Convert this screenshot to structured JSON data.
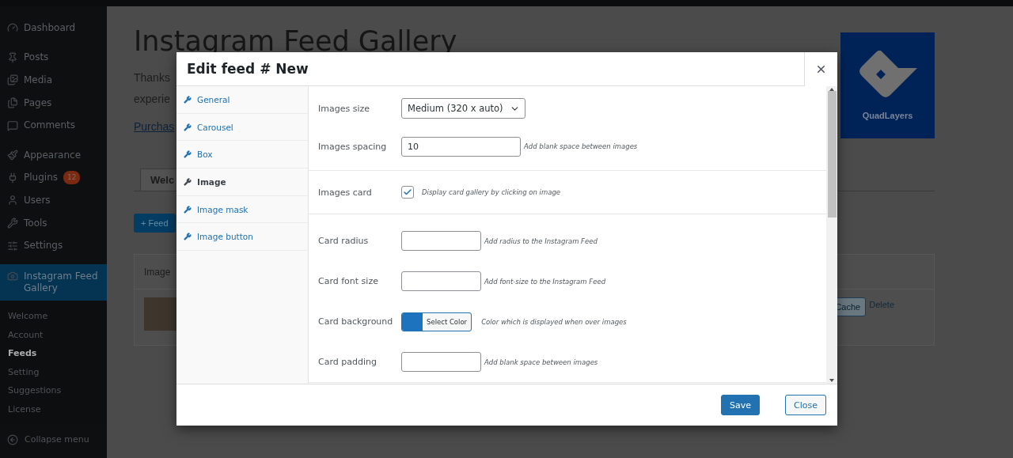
{
  "sidebar": {
    "groups": [
      {
        "items": [
          {
            "label": "Dashboard",
            "selected": false
          }
        ]
      },
      {
        "items": [
          {
            "label": "Posts",
            "selected": false
          },
          {
            "label": "Media",
            "selected": false
          },
          {
            "label": "Pages",
            "selected": false
          },
          {
            "label": "Comments",
            "selected": false
          }
        ]
      },
      {
        "items": [
          {
            "label": "Appearance",
            "selected": false
          },
          {
            "label": "Plugins",
            "badge": "12",
            "selected": false
          },
          {
            "label": "Users",
            "selected": false
          },
          {
            "label": "Tools",
            "selected": false
          },
          {
            "label": "Settings",
            "selected": false
          }
        ]
      },
      {
        "items": [
          {
            "label": "Instagram Feed Gallery",
            "selected": true
          }
        ]
      }
    ],
    "submenu": [
      {
        "label": "Welcome",
        "selected": false
      },
      {
        "label": "Account",
        "selected": false
      },
      {
        "label": "Feeds",
        "selected": true
      },
      {
        "label": "Setting",
        "selected": false
      },
      {
        "label": "Suggestions",
        "selected": false
      },
      {
        "label": "License",
        "selected": false
      }
    ],
    "collapse": "Collapse menu"
  },
  "page": {
    "title": "Instagram Feed Gallery",
    "intro_lines": [
      "Thanks",
      "experie"
    ],
    "link": "Purchas",
    "logo": "QuadLayers",
    "tabs": [
      {
        "label": "Welc",
        "selected": true
      }
    ],
    "add_button": "+ Feed",
    "table": {
      "columns": [
        "Image"
      ],
      "rows": [
        {
          "actions": [
            "Cache",
            "Delete"
          ]
        }
      ]
    }
  },
  "modal": {
    "title": "Edit feed # New",
    "tabs": [
      {
        "label": "General",
        "selected": false
      },
      {
        "label": "Carousel",
        "selected": false
      },
      {
        "label": "Box",
        "selected": false
      },
      {
        "label": "Image",
        "selected": true
      },
      {
        "label": "Image mask",
        "selected": false
      },
      {
        "label": "Image button",
        "selected": false
      }
    ],
    "sections": [
      {
        "fields": [
          {
            "kind": "select",
            "label": "Images size",
            "value": "Medium (320 x auto)"
          },
          {
            "kind": "text",
            "label": "Images spacing",
            "value": "10",
            "help": "Add blank space between images"
          }
        ]
      },
      {
        "fields": [
          {
            "kind": "checkbox",
            "label": "Images card",
            "checked": true,
            "help": "Display card gallery by clicking on image"
          }
        ]
      },
      {
        "fields": [
          {
            "kind": "text",
            "label": "Card radius",
            "help": "Add radius to the Instagram Feed"
          },
          {
            "kind": "text",
            "label": "Card font size",
            "help": "Add font-size to the Instagram Feed"
          },
          {
            "kind": "color",
            "label": "Card background",
            "button": "Select Color",
            "color": "#1e73be",
            "help": "Color which is displayed when over images"
          },
          {
            "kind": "text",
            "label": "Card padding",
            "help": "Add blank space between images"
          }
        ]
      }
    ],
    "buttons": [
      {
        "label": "Save",
        "kind": "primary"
      },
      {
        "label": "Close",
        "kind": "secondary"
      }
    ]
  }
}
